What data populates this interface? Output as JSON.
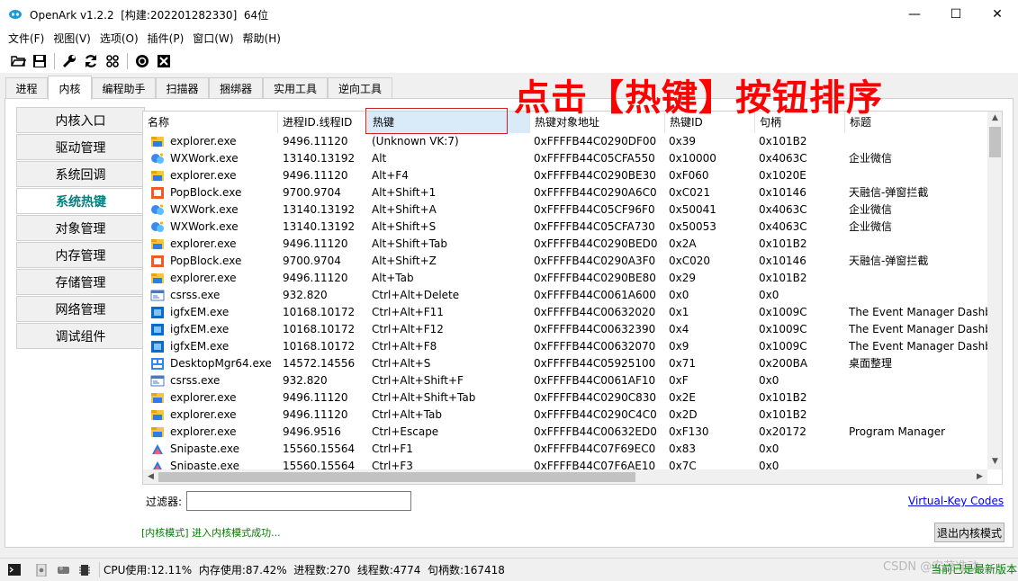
{
  "window": {
    "title": "OpenArk v1.2.2  [构建:202201282330]  64位",
    "minimize_icon": "—",
    "maximize_icon": "☐",
    "close_icon": "✕"
  },
  "menu": [
    "文件(F)",
    "视图(V)",
    "选项(O)",
    "插件(P)",
    "窗口(W)",
    "帮助(H)"
  ],
  "toolbar_icons": [
    "open-folder-icon",
    "save-icon",
    "wrench-icon",
    "refresh-icon",
    "grid-icon",
    "console-icon",
    "close-box-icon"
  ],
  "tabs": [
    "进程",
    "内核",
    "编程助手",
    "扫描器",
    "捆绑器",
    "实用工具",
    "逆向工具"
  ],
  "active_tab": "内核",
  "sidebar": [
    "内核入口",
    "驱动管理",
    "系统回调",
    "系统热键",
    "对象管理",
    "内存管理",
    "存储管理",
    "网络管理",
    "调试组件"
  ],
  "active_sidebar": "系统热键",
  "table": {
    "columns": [
      "名称",
      "进程ID.线程ID",
      "热键",
      "热键对象地址",
      "热键ID",
      "句柄",
      "标题"
    ],
    "sorted_column": "热键",
    "rows": [
      {
        "icon": "explorer-folder-icon",
        "name": "explorer.exe",
        "pid": "9496.11120",
        "hotkey": "(Unknown VK:7)",
        "addr": "0xFFFFB44C0290DF00",
        "kid": "0x39",
        "handle": "0x101B2",
        "title": ""
      },
      {
        "icon": "wxwork-icon",
        "name": "WXWork.exe",
        "pid": "13140.13192",
        "hotkey": "Alt",
        "addr": "0xFFFFB44C05CFA550",
        "kid": "0x10000",
        "handle": "0x4063C",
        "title": "企业微信"
      },
      {
        "icon": "explorer-folder-icon",
        "name": "explorer.exe",
        "pid": "9496.11120",
        "hotkey": "Alt+F4",
        "addr": "0xFFFFB44C0290BE30",
        "kid": "0xF060",
        "handle": "0x1020E",
        "title": ""
      },
      {
        "icon": "popblock-icon",
        "name": "PopBlock.exe",
        "pid": "9700.9704",
        "hotkey": "Alt+Shift+1",
        "addr": "0xFFFFB44C0290A6C0",
        "kid": "0xC021",
        "handle": "0x10146",
        "title": "天融信-弹窗拦截"
      },
      {
        "icon": "wxwork-icon",
        "name": "WXWork.exe",
        "pid": "13140.13192",
        "hotkey": "Alt+Shift+A",
        "addr": "0xFFFFB44C05CF96F0",
        "kid": "0x50041",
        "handle": "0x4063C",
        "title": "企业微信"
      },
      {
        "icon": "wxwork-icon",
        "name": "WXWork.exe",
        "pid": "13140.13192",
        "hotkey": "Alt+Shift+S",
        "addr": "0xFFFFB44C05CFA730",
        "kid": "0x50053",
        "handle": "0x4063C",
        "title": "企业微信"
      },
      {
        "icon": "explorer-folder-icon",
        "name": "explorer.exe",
        "pid": "9496.11120",
        "hotkey": "Alt+Shift+Tab",
        "addr": "0xFFFFB44C0290BED0",
        "kid": "0x2A",
        "handle": "0x101B2",
        "title": ""
      },
      {
        "icon": "popblock-icon",
        "name": "PopBlock.exe",
        "pid": "9700.9704",
        "hotkey": "Alt+Shift+Z",
        "addr": "0xFFFFB44C0290A3F0",
        "kid": "0xC020",
        "handle": "0x10146",
        "title": "天融信-弹窗拦截"
      },
      {
        "icon": "explorer-folder-icon",
        "name": "explorer.exe",
        "pid": "9496.11120",
        "hotkey": "Alt+Tab",
        "addr": "0xFFFFB44C0290BE80",
        "kid": "0x29",
        "handle": "0x101B2",
        "title": ""
      },
      {
        "icon": "csrss-icon",
        "name": "csrss.exe",
        "pid": "932.820",
        "hotkey": "Ctrl+Alt+Delete",
        "addr": "0xFFFFB44C0061A600",
        "kid": "0x0",
        "handle": "0x0",
        "title": ""
      },
      {
        "icon": "igfx-icon",
        "name": "igfxEM.exe",
        "pid": "10168.10172",
        "hotkey": "Ctrl+Alt+F11",
        "addr": "0xFFFFB44C00632020",
        "kid": "0x1",
        "handle": "0x1009C",
        "title": "The Event Manager Dashb"
      },
      {
        "icon": "igfx-icon",
        "name": "igfxEM.exe",
        "pid": "10168.10172",
        "hotkey": "Ctrl+Alt+F12",
        "addr": "0xFFFFB44C00632390",
        "kid": "0x4",
        "handle": "0x1009C",
        "title": "The Event Manager Dashb"
      },
      {
        "icon": "igfx-icon",
        "name": "igfxEM.exe",
        "pid": "10168.10172",
        "hotkey": "Ctrl+Alt+F8",
        "addr": "0xFFFFB44C00632070",
        "kid": "0x9",
        "handle": "0x1009C",
        "title": "The Event Manager Dashb"
      },
      {
        "icon": "desktopmgr-icon",
        "name": "DesktopMgr64.exe",
        "pid": "14572.14556",
        "hotkey": "Ctrl+Alt+S",
        "addr": "0xFFFFB44C05925100",
        "kid": "0x71",
        "handle": "0x200BA",
        "title": "桌面整理"
      },
      {
        "icon": "csrss-icon",
        "name": "csrss.exe",
        "pid": "932.820",
        "hotkey": "Ctrl+Alt+Shift+F",
        "addr": "0xFFFFB44C0061AF10",
        "kid": "0xF",
        "handle": "0x0",
        "title": ""
      },
      {
        "icon": "explorer-folder-icon",
        "name": "explorer.exe",
        "pid": "9496.11120",
        "hotkey": "Ctrl+Alt+Shift+Tab",
        "addr": "0xFFFFB44C0290C830",
        "kid": "0x2E",
        "handle": "0x101B2",
        "title": ""
      },
      {
        "icon": "explorer-folder-icon",
        "name": "explorer.exe",
        "pid": "9496.11120",
        "hotkey": "Ctrl+Alt+Tab",
        "addr": "0xFFFFB44C0290C4C0",
        "kid": "0x2D",
        "handle": "0x101B2",
        "title": ""
      },
      {
        "icon": "explorer-folder-icon",
        "name": "explorer.exe",
        "pid": "9496.9516",
        "hotkey": "Ctrl+Escape",
        "addr": "0xFFFFB44C00632ED0",
        "kid": "0xF130",
        "handle": "0x20172",
        "title": "Program Manager"
      },
      {
        "icon": "snipaste-icon",
        "name": "Snipaste.exe",
        "pid": "15560.15564",
        "hotkey": "Ctrl+F1",
        "addr": "0xFFFFB44C07F69EC0",
        "kid": "0x83",
        "handle": "0x0",
        "title": ""
      },
      {
        "icon": "snipaste-icon",
        "name": "Snipaste.exe",
        "pid": "15560.15564",
        "hotkey": "Ctrl+F3",
        "addr": "0xFFFFB44C07F6AE10",
        "kid": "0x7C",
        "handle": "0x0",
        "title": ""
      }
    ]
  },
  "annotation": "点击【热键】按钮排序",
  "filter": {
    "label": "过滤器:",
    "value": "",
    "placeholder": ""
  },
  "vk_link": "Virtual-Key Codes",
  "status_message": "[内核模式] 进入内核模式成功...",
  "exit_button": "退出内核模式",
  "statusbar": {
    "stats": "CPU使用:12.11%  内存使用:87.42%  进程数:270  线程数:4774  句柄数:167418",
    "version_note": "当前已是最新版本",
    "watermark": "CSDN @安茂准动"
  },
  "colors": {
    "accent": "#008080",
    "annotation": "#ff0000",
    "status_ok": "#008000",
    "link": "#0000ee"
  }
}
